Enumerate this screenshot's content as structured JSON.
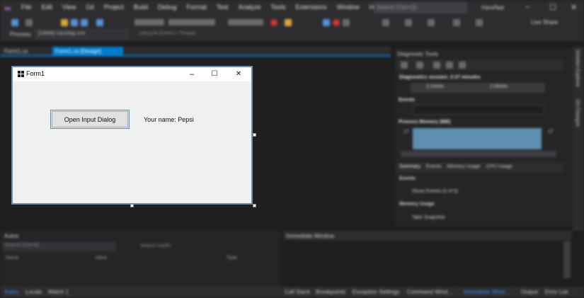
{
  "ide": {
    "menus": [
      "File",
      "Edit",
      "View",
      "Git",
      "Project",
      "Build",
      "Debug",
      "Format",
      "Test",
      "Analyze",
      "Tools",
      "Extensions",
      "Window",
      "Help"
    ],
    "search_placeholder": "Search (Ctrl+Q)",
    "project_name": "InputApp",
    "live_share": "Live Share",
    "process_label": "Process:",
    "process_value": "[24688] InputApp.exe",
    "lifecycle": "Lifecycle Events  •  Thread:",
    "tabs": {
      "code": "Form1.cs",
      "design": "Form1.cs [Design]"
    }
  },
  "form": {
    "caption": "Form1",
    "button_label": "Open Input Dialog",
    "name_label": "Your name: Pepsi",
    "minimize": "–",
    "maximize": "☐",
    "close": "✕"
  },
  "diagnostics": {
    "title": "Diagnostic Tools",
    "session": "Diagnostics session: 2:27 minutes",
    "time1": "2:10min",
    "time2": "2:20min",
    "events": "Events",
    "process_memory": "Process Memory (MB)",
    "mem_val": "17",
    "tabs": [
      "Summary",
      "Events",
      "Memory Usage",
      "CPU Usage"
    ],
    "list": [
      "Events",
      "Show Events (0 of 0)",
      "Memory Usage",
      "Take Snapshot"
    ]
  },
  "autos": {
    "title": "Autos",
    "search": "Search (Ctrl+E)",
    "search_depth": "Search Depth:",
    "columns": [
      "Name",
      "Value",
      "Type"
    ]
  },
  "immediate": {
    "title": "Immediate Window"
  },
  "bottom_tabs": {
    "left": [
      "Autos",
      "Locals",
      "Watch 1"
    ],
    "right": [
      "Call Stack",
      "Breakpoints",
      "Exception Settings",
      "Command Wind...",
      "Immediate Wind...",
      "Output",
      "Error List"
    ]
  },
  "side_strip": [
    "Solution Explorer",
    "Git Changes"
  ]
}
